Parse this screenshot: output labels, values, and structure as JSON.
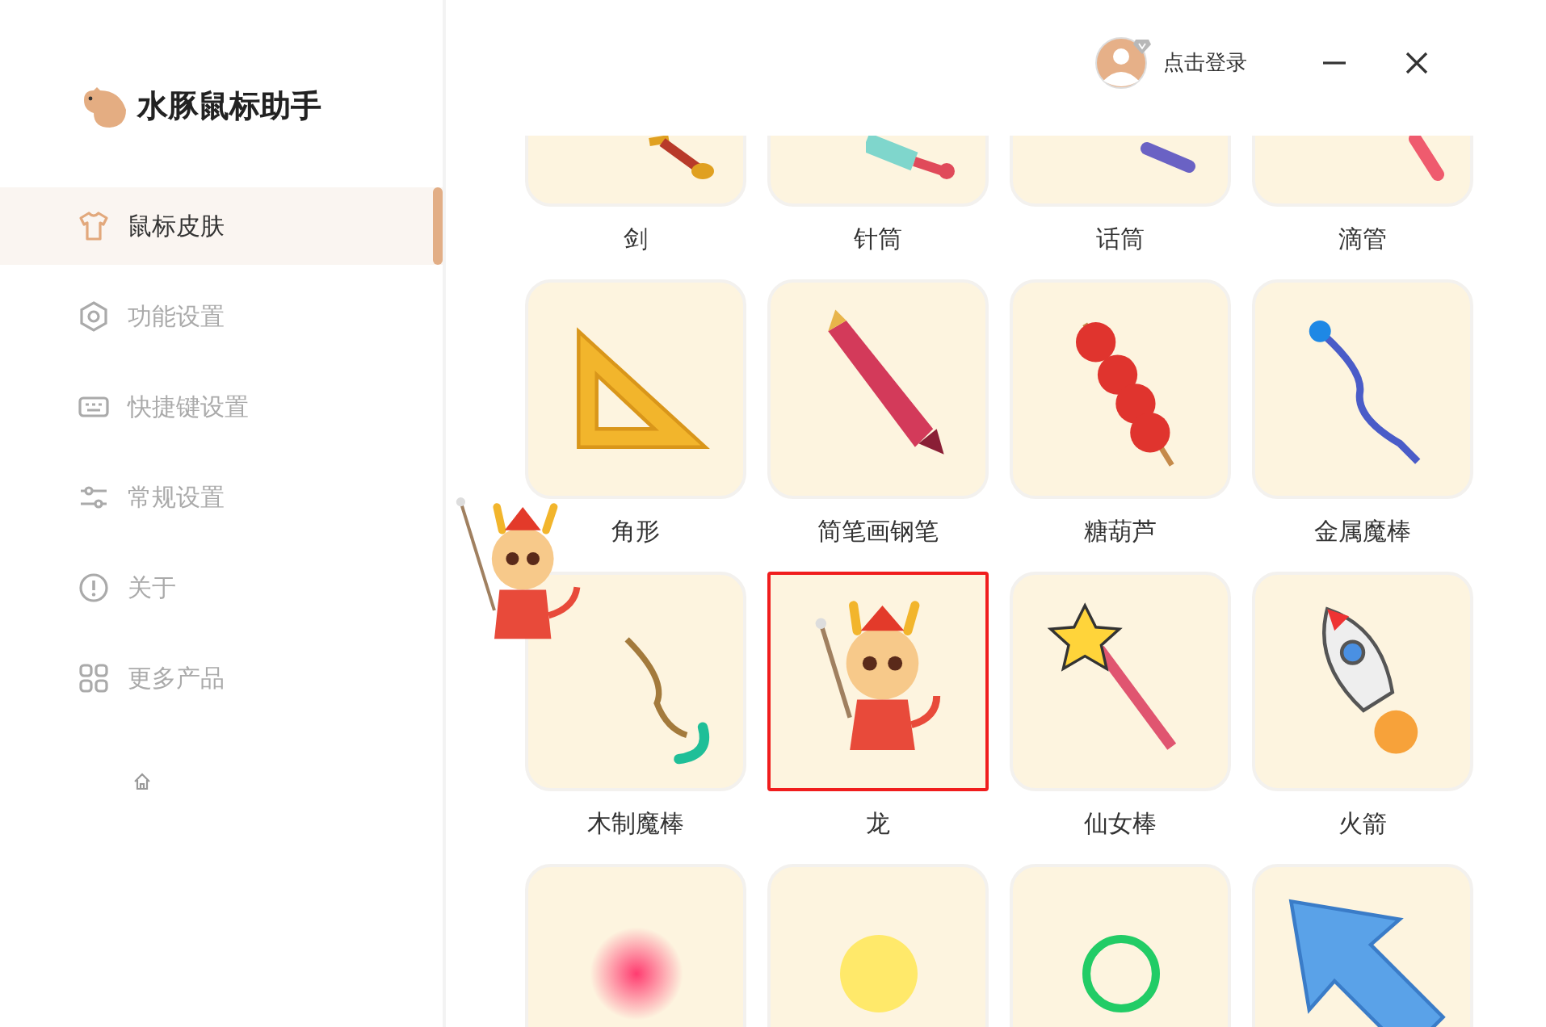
{
  "app": {
    "name": "水豚鼠标助手"
  },
  "nav": [
    {
      "label": "鼠标皮肤",
      "kind": "shirt",
      "selected": true
    },
    {
      "label": "功能设置",
      "kind": "hexagon",
      "selected": false
    },
    {
      "label": "快捷键设置",
      "kind": "keyboard",
      "selected": false
    },
    {
      "label": "常规设置",
      "kind": "sliders",
      "selected": false
    },
    {
      "label": "关于",
      "kind": "info",
      "selected": false
    },
    {
      "label": "更多产品",
      "kind": "grid",
      "selected": false
    }
  ],
  "header": {
    "login": "点击登录"
  },
  "skins": [
    {
      "label": "剑",
      "kind": "sword",
      "selected": false
    },
    {
      "label": "针筒",
      "kind": "syringe",
      "selected": false
    },
    {
      "label": "话筒",
      "kind": "mic",
      "selected": false
    },
    {
      "label": "滴管",
      "kind": "dropper",
      "selected": false
    },
    {
      "label": "角形",
      "kind": "triangle",
      "selected": false
    },
    {
      "label": "简笔画钢笔",
      "kind": "pen",
      "selected": false
    },
    {
      "label": "糖葫芦",
      "kind": "candy",
      "selected": false
    },
    {
      "label": "金属魔棒",
      "kind": "metalwand",
      "selected": false
    },
    {
      "label": "木制魔棒",
      "kind": "woodwand",
      "selected": false
    },
    {
      "label": "龙",
      "kind": "dragon",
      "selected": true
    },
    {
      "label": "仙女棒",
      "kind": "starwand",
      "selected": false
    },
    {
      "label": "火箭",
      "kind": "rocket",
      "selected": false
    },
    {
      "kind": "pinkdot",
      "selected": false
    },
    {
      "kind": "yellowdot",
      "selected": false
    },
    {
      "kind": "greenring",
      "selected": false
    },
    {
      "kind": "arrow",
      "selected": false
    }
  ]
}
